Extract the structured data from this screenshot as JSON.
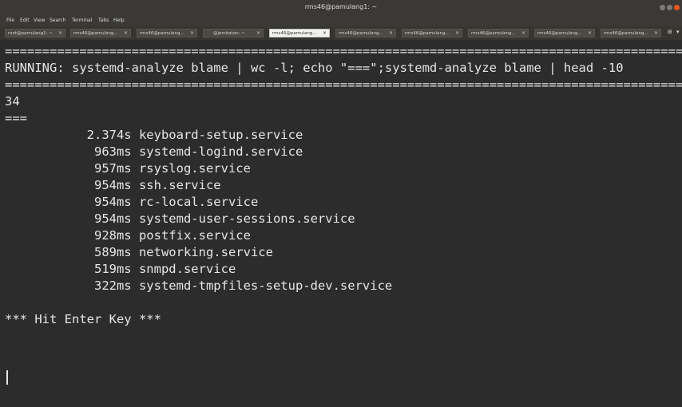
{
  "window": {
    "title": "rms46@pamulang1: ~"
  },
  "menu": [
    "File",
    "Edit",
    "View",
    "Search",
    "Terminal",
    "Tabs",
    "Help"
  ],
  "tabs": [
    {
      "label": "root@pamulang1: ~",
      "active": false
    },
    {
      "label": "rms46@pamulang...",
      "active": false
    },
    {
      "label": "rms46@pamulang...",
      "active": false
    },
    {
      "label": "@jembatan: ~",
      "active": false
    },
    {
      "label": "rms46@pamulang...",
      "active": true
    },
    {
      "label": "rms46@pamulang...",
      "active": false
    },
    {
      "label": "rms46@pamulang...",
      "active": false
    },
    {
      "label": "rms46@pamulang...",
      "active": false
    },
    {
      "label": "rms46@pamulang...",
      "active": false
    },
    {
      "label": "rms46@pamulang...",
      "active": false
    }
  ],
  "tab_close_glyph": "×",
  "terminal": {
    "lines": [
      "=================================================================================================",
      "RUNNING: systemd-analyze blame | wc -l; echo \"===\";systemd-analyze blame | head -10",
      "=================================================================================================",
      "34",
      "===",
      "           2.374s keyboard-setup.service",
      "            963ms systemd-logind.service",
      "            957ms rsyslog.service",
      "            954ms ssh.service",
      "            954ms rc-local.service",
      "            954ms systemd-user-sessions.service",
      "            928ms postfix.service",
      "            589ms networking.service",
      "            519ms snmpd.service",
      "            322ms systemd-tmpfiles-setup-dev.service",
      "",
      "*** Hit Enter Key ***"
    ]
  },
  "colors": {
    "background": "#2c2c2c",
    "foreground": "#e6e6e6",
    "titlebar": "#3a3935",
    "close_button": "#e95420"
  }
}
